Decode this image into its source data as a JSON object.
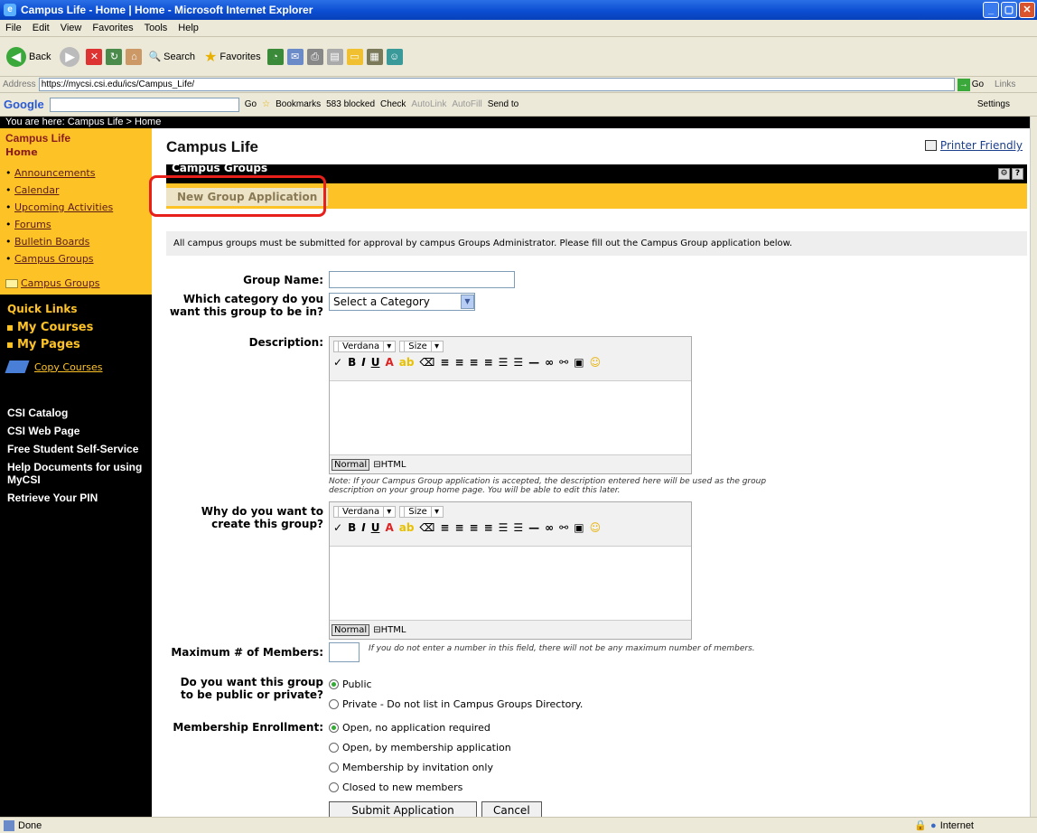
{
  "window": {
    "title": "Campus Life - Home | Home - Microsoft Internet Explorer"
  },
  "menu": [
    "File",
    "Edit",
    "View",
    "Favorites",
    "Tools",
    "Help"
  ],
  "toolbar": {
    "back": "Back",
    "search": "Search",
    "favorites": "Favorites"
  },
  "address": {
    "label": "Address",
    "url": "https://mycsi.csi.edu/ics/Campus_Life/",
    "go": "Go",
    "links": "Links"
  },
  "google": {
    "logo": "Google",
    "go": "Go",
    "bookmarks": "Bookmarks",
    "blocked": "583 blocked",
    "check": "Check",
    "autolink": "AutoLink",
    "autofill": "AutoFill",
    "sendto": "Send to",
    "settings": "Settings"
  },
  "breadcrumb": "You are here:  Campus Life > Home",
  "sidebar": {
    "title": "Campus Life",
    "home": "Home",
    "nav": [
      "Announcements",
      "Calendar",
      "Upcoming Activities",
      "Forums",
      "Bulletin Boards",
      "Campus Groups"
    ],
    "folder_link": "Campus Groups",
    "quick_links_title": "Quick Links",
    "quick_links": [
      "My Courses",
      "My Pages"
    ],
    "copy_courses": "Copy Courses",
    "links": [
      "CSI Catalog",
      "CSI Web Page",
      "Free Student Self-Service",
      "Help Documents for using MyCSI",
      "Retrieve Your PIN"
    ]
  },
  "main": {
    "page_title": "Campus Life",
    "printer_friendly": "Printer Friendly",
    "section_title": "Campus Groups",
    "tab": "New Group Application",
    "intro": "All campus groups must be submitted for approval by campus Groups Administrator. Please fill out the Campus Group application below."
  },
  "form": {
    "group_name_label": "Group Name:",
    "category_label": "Which category do you want this group to be in?",
    "category_value": "Select a Category",
    "description_label": "Description:",
    "editor_font": "Verdana",
    "editor_size": "Size",
    "editor_normal": "Normal",
    "editor_html": "HTML",
    "description_note": "Note: If your Campus Group application is accepted, the description entered here will be used as the group description on your group home page. You will be able to edit this later.",
    "why_label": "Why do you want to create this group?",
    "max_label": "Maximum # of Members:",
    "max_note": "If you do not enter a number in this field, there will not be any maximum number of members.",
    "privacy_label": "Do you want this group to be public or private?",
    "privacy_options": [
      "Public",
      "Private - Do not list in Campus Groups Directory."
    ],
    "enrollment_label": "Membership Enrollment:",
    "enrollment_options": [
      "Open, no application required",
      "Open, by membership application",
      "Membership by invitation only",
      "Closed to new members"
    ],
    "submit": "Submit Application",
    "cancel": "Cancel"
  },
  "status": {
    "left": "Done",
    "zone": "Internet"
  }
}
